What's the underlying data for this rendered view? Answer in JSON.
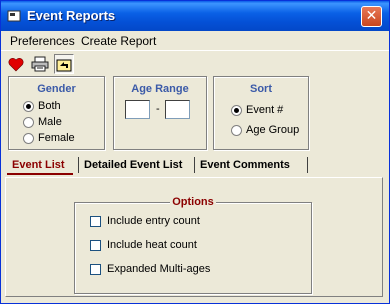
{
  "window": {
    "title": "Event Reports",
    "close_symbol": "✕"
  },
  "menu": {
    "items": [
      "Preferences",
      "Create Report"
    ]
  },
  "toolbar": {
    "buttons": [
      "heart-icon",
      "printer-icon",
      "export-icon"
    ]
  },
  "gender": {
    "title": "Gender",
    "options": [
      "Both",
      "Male",
      "Female"
    ],
    "selected": "Both"
  },
  "age_range": {
    "title": "Age Range",
    "from": "",
    "to": "",
    "separator": "-"
  },
  "sort": {
    "title": "Sort",
    "options": [
      "Event #",
      "Age Group"
    ],
    "selected": "Event #"
  },
  "tabs": {
    "items": [
      "Event List",
      "Detailed Event List",
      "Event Comments"
    ],
    "active": "Event List"
  },
  "options": {
    "title": "Options",
    "items": [
      {
        "label": "Include entry count",
        "checked": false
      },
      {
        "label": "Include heat count",
        "checked": false
      },
      {
        "label": "Expanded Multi-ages",
        "checked": false
      }
    ]
  }
}
